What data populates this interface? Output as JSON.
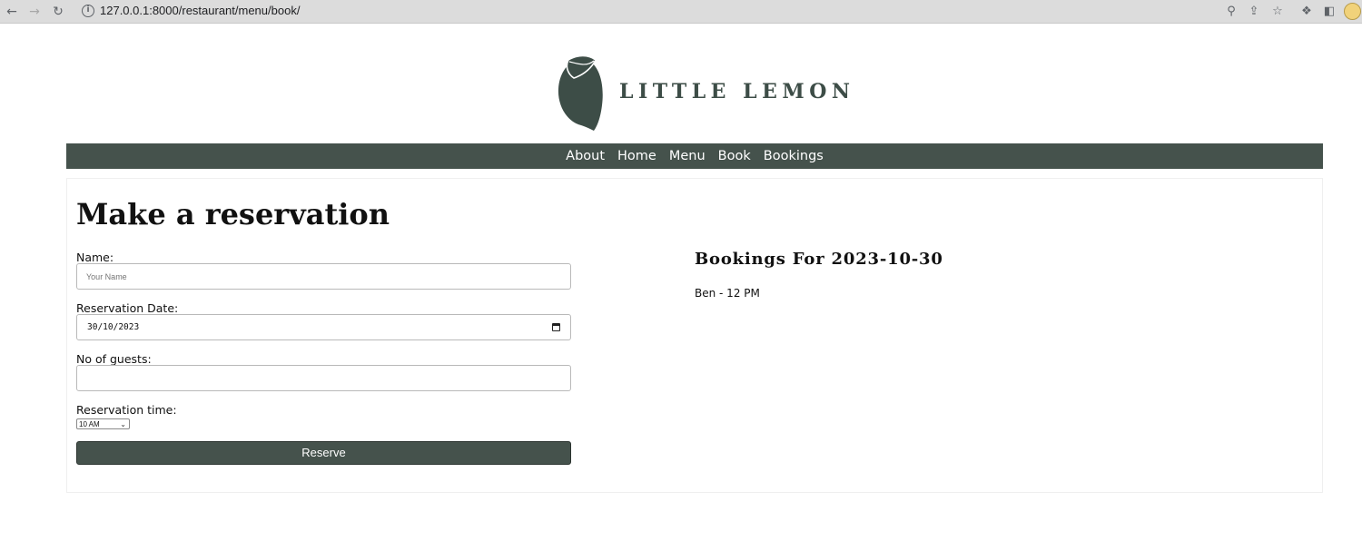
{
  "browser": {
    "url": "127.0.0.1:8000/restaurant/menu/book/",
    "back_icon": "arrow-left-icon",
    "forward_icon": "arrow-right-icon",
    "reload_icon": "reload-icon"
  },
  "logo": {
    "brand": "LITTLE LEMON",
    "color": "#3d4d47"
  },
  "nav": {
    "items": [
      {
        "label": "About"
      },
      {
        "label": "Home"
      },
      {
        "label": "Menu"
      },
      {
        "label": "Book"
      },
      {
        "label": "Bookings"
      }
    ],
    "background": "#45524c"
  },
  "form": {
    "title": "Make a reservation",
    "name_label": "Name:",
    "name_placeholder": "Your Name",
    "name_value": "",
    "date_label": "Reservation Date:",
    "date_value": "30/10/2023",
    "guests_label": "No of guests:",
    "guests_value": "",
    "time_label": "Reservation time:",
    "time_value": "10 AM",
    "submit_label": "Reserve"
  },
  "bookings": {
    "title": "Bookings For 2023-10-30",
    "entries": [
      "Ben - 12 PM"
    ]
  }
}
